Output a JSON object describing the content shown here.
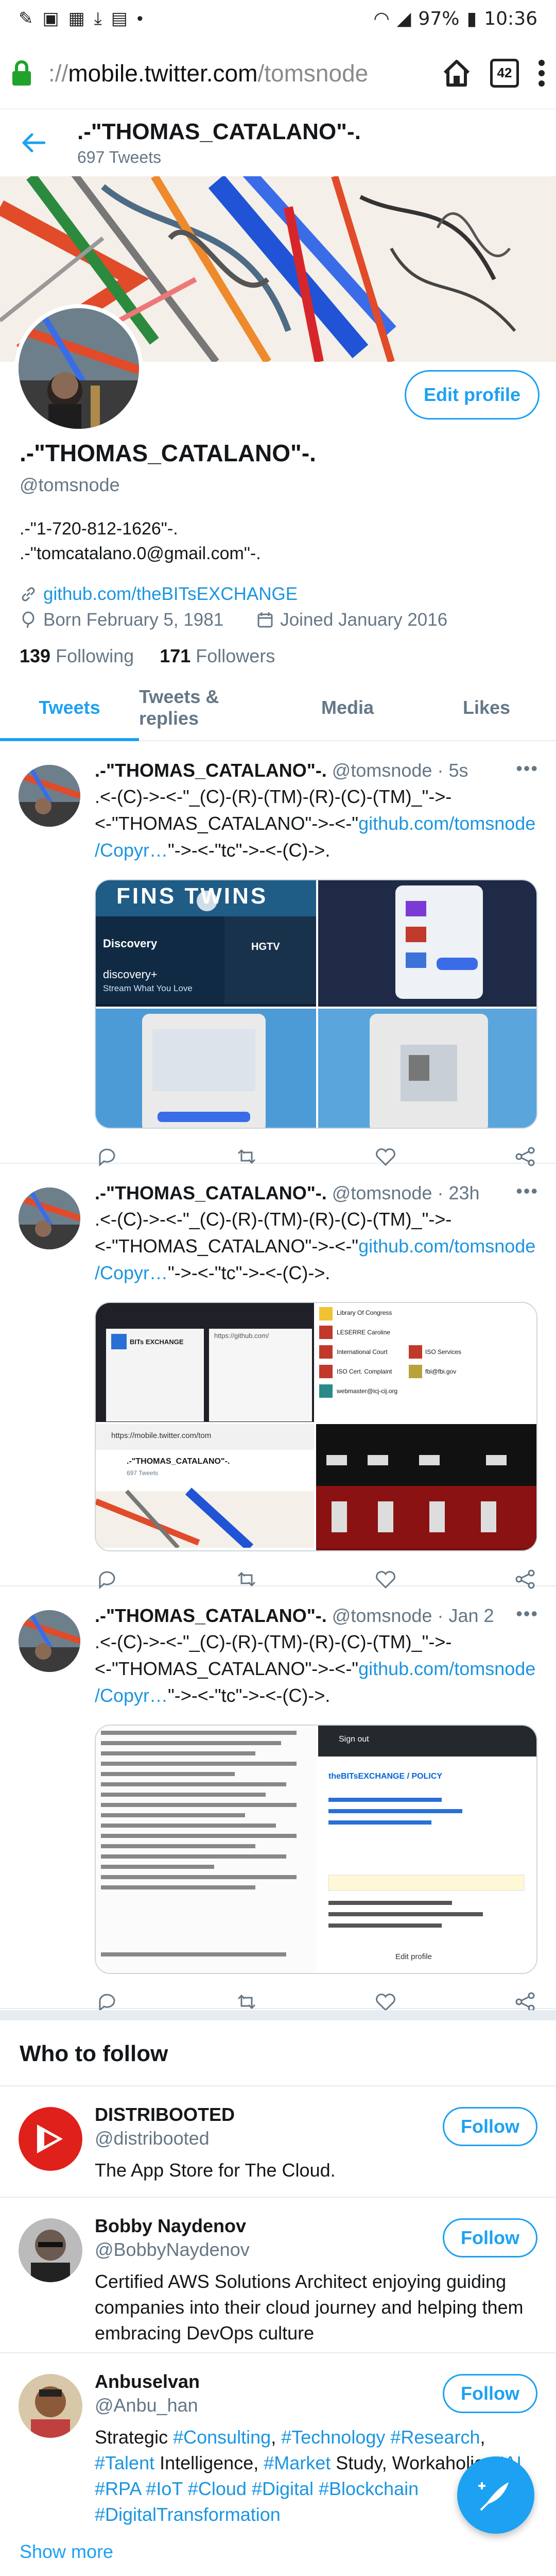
{
  "status_bar": {
    "battery": "97%",
    "time": "10:36"
  },
  "browser": {
    "url_scheme": "://",
    "url_host": "mobile.twitter.com",
    "url_path": "/tomsnode",
    "tab_count": "42"
  },
  "header": {
    "name": ".-\"THOMAS_CATALANO\"-.",
    "tweet_count": "697 Tweets"
  },
  "profile": {
    "name": ".-\"THOMAS_CATALANO\"-.",
    "handle": "@tomsnode",
    "edit_label": "Edit profile",
    "bio_line1": ".-\"1-720-812-1626\"-.",
    "bio_line2": ".-\"tomcatalano.0@gmail.com\"-.",
    "link": "github.com/theBITsEXCHANGE",
    "born": "Born February 5, 1981",
    "joined": "Joined January 2016",
    "following_count": "139",
    "following_label": "Following",
    "followers_count": "171",
    "followers_label": "Followers"
  },
  "tabs": [
    {
      "label": "Tweets",
      "active": true
    },
    {
      "label": "Tweets & replies",
      "active": false
    },
    {
      "label": "Media",
      "active": false
    },
    {
      "label": "Likes",
      "active": false
    }
  ],
  "tweets": [
    {
      "name": ".-\"THOMAS_CATALANO\"-.",
      "handle": "@tomsnode",
      "time": "· 5s",
      "line1": ".<-(C)->-<-\"_(C)-(R)-(TM)-(R)-(C)-(TM)_\"->-",
      "line2_pre": "<-\"THOMAS_CATALANO\"->-<-\"",
      "line2_link": "github.com/tomsnode",
      "line3_link": "/Copyr…",
      "line3_post": "\"->-<-\"tc\"->-<-(C)->.",
      "media_text": [
        "FINS TWINS",
        "Discovery",
        "discovery+",
        "Stream What You Love",
        "HGTV"
      ]
    },
    {
      "name": ".-\"THOMAS_CATALANO\"-.",
      "handle": "@tomsnode",
      "time": "· 23h",
      "line1": ".<-(C)->-<-\"_(C)-(R)-(TM)-(R)-(C)-(TM)_\"->-",
      "line2_pre": "<-\"THOMAS_CATALANO\"->-<-\"",
      "line2_link": "github.com/tomsnode",
      "line3_link": "/Copyr…",
      "line3_post": "\"->-<-\"tc\"->-<-(C)->.",
      "media_text": [
        "BITs EXCHANGE",
        "https://github.com/",
        "https://mobile.twitter.com/tom",
        ".-\"THOMAS_CATALANO\"-.",
        "697 Tweets",
        "Library Of Congress",
        "LESERRE Caroline",
        "International Court",
        "ISO Services",
        "ISO Cert. Complaint",
        "fbi@fbi.gov",
        "webmaster@icj-cij.org"
      ]
    },
    {
      "name": ".-\"THOMAS_CATALANO\"-.",
      "handle": "@tomsnode",
      "time": "· Jan 2",
      "line1": ".<-(C)->-<-\"_(C)-(R)-(TM)-(R)-(C)-(TM)_\"->-",
      "line2_pre": "<-\"THOMAS_CATALANO\"->-<-\"",
      "line2_link": "github.com/tomsnode",
      "line3_link": "/Copyr…",
      "line3_post": "\"->-<-\"tc\"->-<-(C)->.",
      "media_text": [
        "Sign out",
        "theBITsEXCHANGE / POLICY",
        "Edit profile"
      ]
    }
  ],
  "who_to_follow": {
    "title": "Who to follow",
    "follow_label": "Follow",
    "accounts": [
      {
        "name": "DISTRIBOOTED",
        "handle": "@distribooted",
        "desc": "The App Store for The Cloud."
      },
      {
        "name": "Bobby Naydenov",
        "handle": "@BobbyNaydenov",
        "desc": "Certified AWS Solutions Architect enjoying guiding companies into their cloud journey and helping them embracing DevOps culture"
      },
      {
        "name": "Anbuselvan",
        "handle": "@Anbu_han",
        "desc_parts": [
          "Strategic ",
          "#Consulting",
          ", ",
          "#Technology",
          " ",
          "#Research",
          ", ",
          "#Talent",
          " Intelligence, ",
          "#Market",
          " Study, Workaholic, ",
          "#AI",
          " ",
          "#RPA",
          " ",
          "#IoT",
          " ",
          "#Cloud",
          " ",
          "#Digital",
          " ",
          "#Blockchain",
          " ",
          "#DigitalTransformation"
        ]
      }
    ],
    "show_more": "Show more"
  },
  "colors": {
    "accent": "#1da1f2",
    "link": "#1b95e0",
    "muted": "#657786"
  }
}
